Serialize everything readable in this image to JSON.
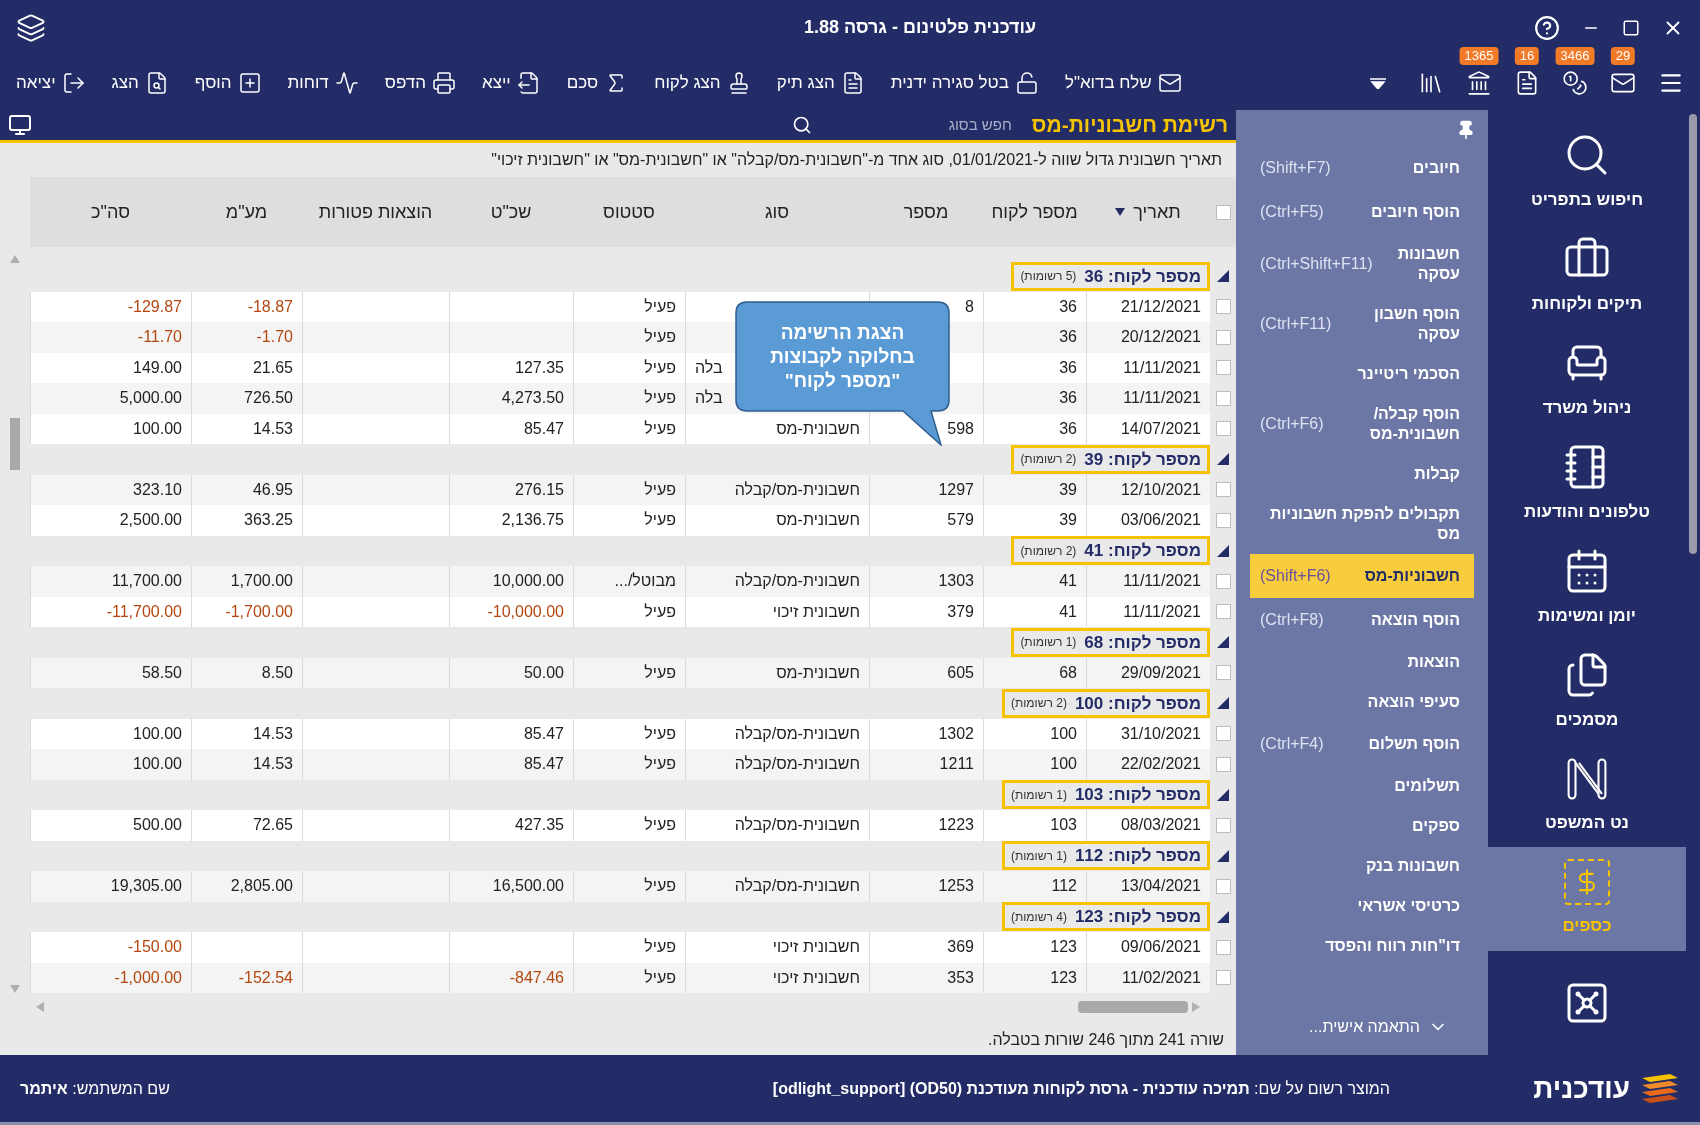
{
  "window": {
    "title": "עודכנית פלטינום - גרסה 1.88"
  },
  "notifications": [
    {
      "count": "29"
    },
    {
      "count": "3466"
    },
    {
      "count": "16"
    },
    {
      "count": "1365"
    }
  ],
  "toolbar": [
    {
      "label": "שלח בדוא\"ל"
    },
    {
      "label": "בטל סגירה ידנית"
    },
    {
      "label": "הצג תיק"
    },
    {
      "label": "הצג לקוח"
    },
    {
      "label": "סכם"
    },
    {
      "label": "ייצא"
    },
    {
      "label": "הדפס"
    },
    {
      "label": "דוחות"
    },
    {
      "label": "הוסף"
    },
    {
      "label": "הצג"
    },
    {
      "label": "יציאה"
    }
  ],
  "list_header": {
    "title": "רשימת חשבוניות-מס",
    "search": {
      "placeholder": "חפש בסוג"
    }
  },
  "filter": "תאריך חשבונית גדול שווה ל-01/01/2021, סוג אחד מ-\"חשבונית-מס/קבלה\" או \"חשבונית-מס\" או \"חשבונית זיכוי\"",
  "table": {
    "select_all": {
      "checked": false
    },
    "columns": [
      {
        "label": "תאריך",
        "sorted": true
      },
      {
        "label": "מספר לקוח",
        "sorted": false
      },
      {
        "label": "מספר",
        "sorted": false
      },
      {
        "label": "סוג",
        "sorted": false
      },
      {
        "label": "סטטוס",
        "sorted": false
      },
      {
        "label": "שכ\"ט",
        "sorted": false
      },
      {
        "label": "הוצאות פטורות",
        "sorted": false
      },
      {
        "label": "מע\"מ",
        "sorted": false
      },
      {
        "label": "סה\"כ",
        "sorted": false
      }
    ],
    "groups": [
      {
        "title": "מספר לקוח: 36",
        "count": "(5 רשומות)",
        "expanded": true,
        "rows": [
          {
            "checked": false,
            "negative": true,
            "date": "21/12/2021",
            "customer": "36",
            "number": "8",
            "status": "פעיל",
            "vat": "-18.87",
            "total": "-129.87"
          },
          {
            "checked": false,
            "negative": true,
            "date": "20/12/2021",
            "customer": "36",
            "status": "פעיל",
            "vat": "-1.70",
            "total": "-11.70"
          },
          {
            "checked": false,
            "negative": false,
            "date": "11/11/2021",
            "customer": "36",
            "type": "בלה",
            "type_cut": true,
            "status": "פעיל",
            "fee": "127.35",
            "vat": "21.65",
            "total": "149.00"
          },
          {
            "checked": false,
            "negative": false,
            "date": "11/11/2021",
            "customer": "36",
            "type": "בלה",
            "type_cut": true,
            "status": "פעיל",
            "fee": "4,273.50",
            "vat": "726.50",
            "total": "5,000.00"
          },
          {
            "checked": false,
            "negative": false,
            "date": "14/07/2021",
            "customer": "36",
            "number": "598",
            "type": "חשבונית-מס",
            "status": "פעיל",
            "fee": "85.47",
            "vat": "14.53",
            "total": "100.00"
          }
        ]
      },
      {
        "title": "מספר לקוח: 39",
        "count": "(2 רשומות)",
        "expanded": true,
        "rows": [
          {
            "checked": false,
            "negative": false,
            "date": "12/10/2021",
            "customer": "39",
            "number": "1297",
            "type": "חשבונית-מס/קבלה",
            "status": "פעיל",
            "fee": "276.15",
            "vat": "46.95",
            "total": "323.10"
          },
          {
            "checked": false,
            "negative": false,
            "date": "03/06/2021",
            "customer": "39",
            "number": "579",
            "type": "חשבונית-מס",
            "status": "פעיל",
            "fee": "2,136.75",
            "vat": "363.25",
            "total": "2,500.00"
          }
        ]
      },
      {
        "title": "מספר לקוח: 41",
        "count": "(2 רשומות)",
        "expanded": true,
        "rows": [
          {
            "checked": false,
            "negative": false,
            "date": "11/11/2021",
            "customer": "41",
            "number": "1303",
            "type": "חשבונית-מס/קבלה",
            "status": "מבוטל/...",
            "fee": "10,000.00",
            "vat": "1,700.00",
            "total": "11,700.00"
          },
          {
            "checked": false,
            "negative": true,
            "date": "11/11/2021",
            "customer": "41",
            "number": "379",
            "type": "חשבונית זיכוי",
            "status": "פעיל",
            "fee": "-10,000.00",
            "vat": "-1,700.00",
            "total": "-11,700.00"
          }
        ]
      },
      {
        "title": "מספר לקוח: 68",
        "count": "(1 רשומות)",
        "expanded": true,
        "rows": [
          {
            "checked": false,
            "negative": false,
            "date": "29/09/2021",
            "customer": "68",
            "number": "605",
            "type": "חשבונית-מס",
            "status": "פעיל",
            "fee": "50.00",
            "vat": "8.50",
            "total": "58.50"
          }
        ]
      },
      {
        "title": "מספר לקוח: 100",
        "count": "(2 רשומות)",
        "expanded": true,
        "rows": [
          {
            "checked": false,
            "negative": false,
            "date": "31/10/2021",
            "customer": "100",
            "number": "1302",
            "type": "חשבונית-מס/קבלה",
            "status": "פעיל",
            "fee": "85.47",
            "vat": "14.53",
            "total": "100.00"
          },
          {
            "checked": false,
            "negative": false,
            "date": "22/02/2021",
            "customer": "100",
            "number": "1211",
            "type": "חשבונית-מס/קבלה",
            "status": "פעיל",
            "fee": "85.47",
            "vat": "14.53",
            "total": "100.00"
          }
        ]
      },
      {
        "title": "מספר לקוח: 103",
        "count": "(1 רשומות)",
        "expanded": true,
        "rows": [
          {
            "checked": false,
            "negative": false,
            "date": "08/03/2021",
            "customer": "103",
            "number": "1223",
            "type": "חשבונית-מס/קבלה",
            "status": "פעיל",
            "fee": "427.35",
            "vat": "72.65",
            "total": "500.00"
          }
        ]
      },
      {
        "title": "מספר לקוח: 112",
        "count": "(1 רשומות)",
        "expanded": true,
        "rows": [
          {
            "checked": false,
            "negative": false,
            "date": "13/04/2021",
            "customer": "112",
            "number": "1253",
            "type": "חשבונית-מס/קבלה",
            "status": "פעיל",
            "fee": "16,500.00",
            "vat": "2,805.00",
            "total": "19,305.00"
          }
        ]
      },
      {
        "title": "מספר לקוח: 123",
        "count": "(4 רשומות)",
        "expanded": true,
        "rows": [
          {
            "checked": false,
            "negative": true,
            "date": "09/06/2021",
            "customer": "123",
            "number": "369",
            "type": "חשבונית זיכוי",
            "status": "פעיל",
            "total": "-150.00"
          },
          {
            "checked": false,
            "negative": true,
            "date": "11/02/2021",
            "customer": "123",
            "number": "353",
            "type": "חשבונית זיכוי",
            "status": "פעיל",
            "fee": "-847.46",
            "vat": "-152.54",
            "total": "-1,000.00"
          }
        ]
      }
    ]
  },
  "callout": "הצגת הרשימה בחלוקה לקבוצות \"מספר לקוח\"",
  "status": "שורה 241 מתוך 246 שורות בטבלה.",
  "menu": {
    "items": [
      {
        "label": "חיובים",
        "shortcut": "(Shift+F7)",
        "selected": false
      },
      {
        "label": "הוסף חיובים",
        "shortcut": "(Ctrl+F5)",
        "selected": false
      },
      {
        "label": "חשבונות עסקה",
        "shortcut": "(Ctrl+Shift+F11)",
        "selected": false
      },
      {
        "label": "הוסף חשבון עסקה",
        "shortcut": "(Ctrl+F11)",
        "selected": false
      },
      {
        "label": "הסכמי ריטיינר",
        "selected": false
      },
      {
        "label": "הוסף קבלה/ חשבונית-מס",
        "shortcut": "(Ctrl+F6)",
        "selected": false
      },
      {
        "label": "קבלות",
        "selected": false
      },
      {
        "label": "תקבולים להפקת חשבוניות מס",
        "selected": false
      },
      {
        "label": "חשבוניות-מס",
        "shortcut": "(Shift+F6)",
        "selected": true
      },
      {
        "label": "הוסף הוצאה",
        "shortcut": "(Ctrl+F8)",
        "selected": false
      },
      {
        "label": "הוצאות",
        "selected": false
      },
      {
        "label": "סעיפי הוצאה",
        "selected": false
      },
      {
        "label": "הוסף תשלום",
        "shortcut": "(Ctrl+F4)",
        "selected": false
      },
      {
        "label": "תשלומים",
        "selected": false
      },
      {
        "label": "ספקים",
        "selected": false
      },
      {
        "label": "חשבונות בנק",
        "selected": false
      },
      {
        "label": "כרטיסי אשראי",
        "selected": false
      },
      {
        "label": "דו\"חות רווח והפסד",
        "selected": false
      }
    ],
    "customize": "התאמה אישית..."
  },
  "sidebar": {
    "items": [
      {
        "label": "חיפוש בתפריט",
        "selected": false
      },
      {
        "label": "תיקים ולקוחות",
        "selected": false
      },
      {
        "label": "ניהול משרד",
        "selected": false
      },
      {
        "label": "טלפונים והודעות",
        "selected": false
      },
      {
        "label": "יומן ומשימות",
        "selected": false
      },
      {
        "label": "מסמכים",
        "selected": false
      },
      {
        "label": "נט המשפט",
        "selected": false
      },
      {
        "label": "כספים",
        "selected": true
      },
      {
        "selected": false
      }
    ]
  },
  "footer": {
    "brand": "עודכנית",
    "registration": "המוצר רשום על שם: **תמיכה עודכנית - גרסת לקוחות מעודכנת (OD50) [odlight_support]**",
    "user": "שם המשתמש: **איתמר**"
  }
}
